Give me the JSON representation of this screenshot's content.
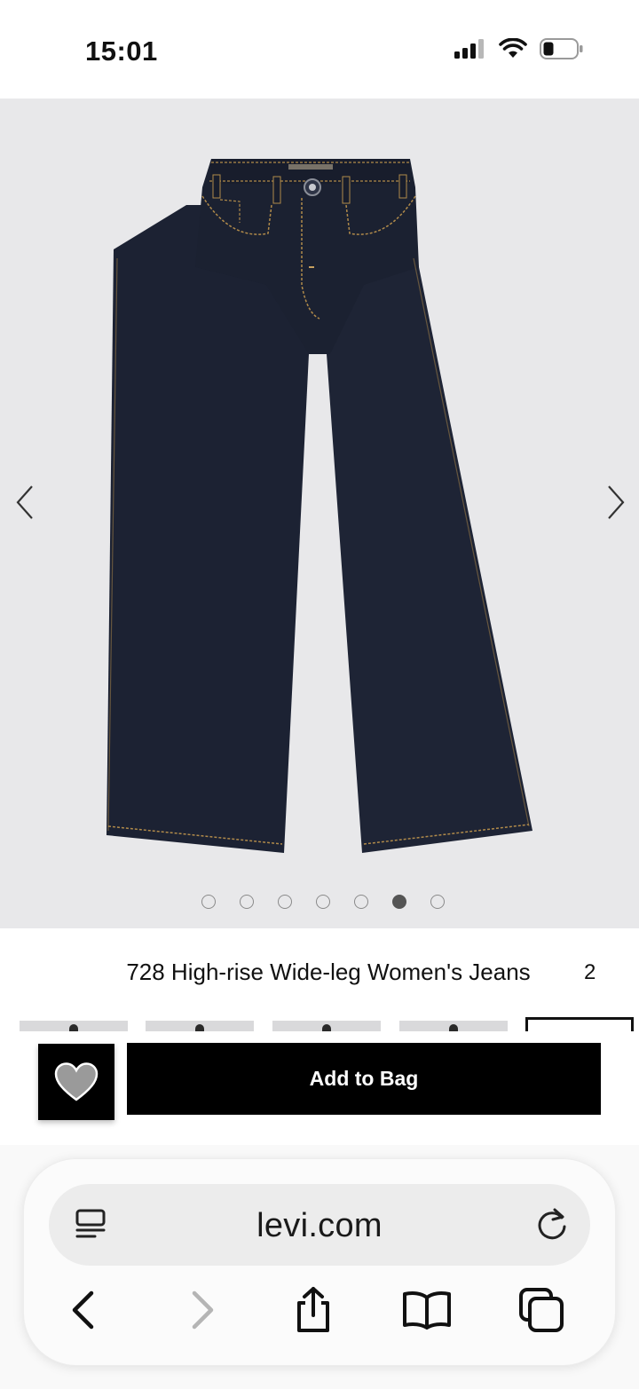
{
  "status_bar": {
    "time": "15:01",
    "icons": [
      "cellular-signal-icon",
      "wifi-icon",
      "battery-icon"
    ]
  },
  "product": {
    "title": "728 High-rise Wide-leg Women's Jeans",
    "title_peek": "2",
    "carousel": {
      "dot_count": 7,
      "active_index": 5
    },
    "thumbnail_count": 5,
    "selected_thumbnail": 4
  },
  "actions": {
    "wishlist_icon": "heart-icon",
    "add_to_bag_label": "Add to Bag"
  },
  "browser": {
    "url": "levi.com",
    "toolbar_icons": [
      "back-icon",
      "forward-icon",
      "share-icon",
      "bookmarks-icon",
      "tabs-icon"
    ]
  },
  "colors": {
    "denim": "#1c2233",
    "stitching": "#b08a4a",
    "image_background": "#e8e8ea",
    "button_black": "#000000"
  }
}
